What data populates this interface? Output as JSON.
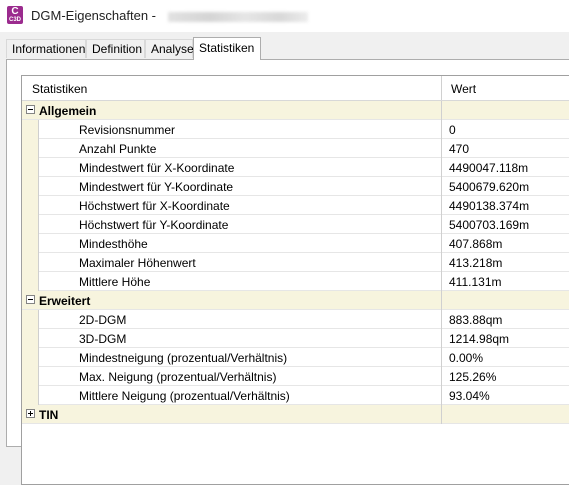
{
  "window": {
    "title": "DGM-Eigenschaften - "
  },
  "tabs": [
    {
      "label": "Informationen",
      "active": false
    },
    {
      "label": "Definition",
      "active": false
    },
    {
      "label": "Analyse",
      "active": false
    },
    {
      "label": "Statistiken",
      "active": true
    }
  ],
  "grid": {
    "header_name": "Statistiken",
    "header_value": "Wert",
    "categories": [
      {
        "label": "Allgemein",
        "expanded": true,
        "rows": [
          {
            "name": "Revisionsnummer",
            "value": "0"
          },
          {
            "name": "Anzahl Punkte",
            "value": "470"
          },
          {
            "name": "Mindestwert für X-Koordinate",
            "value": "4490047.118m"
          },
          {
            "name": "Mindestwert für Y-Koordinate",
            "value": "5400679.620m"
          },
          {
            "name": "Höchstwert für X-Koordinate",
            "value": "4490138.374m"
          },
          {
            "name": "Höchstwert für Y-Koordinate",
            "value": "5400703.169m"
          },
          {
            "name": "Mindesthöhe",
            "value": "407.868m"
          },
          {
            "name": "Maximaler Höhenwert",
            "value": "413.218m"
          },
          {
            "name": "Mittlere Höhe",
            "value": "411.131m"
          }
        ]
      },
      {
        "label": "Erweitert",
        "expanded": true,
        "rows": [
          {
            "name": "2D-DGM",
            "value": "883.88qm"
          },
          {
            "name": "3D-DGM",
            "value": "1214.98qm"
          },
          {
            "name": "Mindestneigung (prozentual/Verhältnis)",
            "value": "0.00%"
          },
          {
            "name": "Max. Neigung (prozentual/Verhältnis)",
            "value": "125.26%"
          },
          {
            "name": "Mittlere Neigung (prozentual/Verhältnis)",
            "value": "93.04%"
          }
        ]
      },
      {
        "label": "TIN",
        "expanded": false,
        "rows": []
      }
    ]
  },
  "colors": {
    "category_bg": "#f7f4de",
    "app_icon": "#9b2b8e"
  }
}
